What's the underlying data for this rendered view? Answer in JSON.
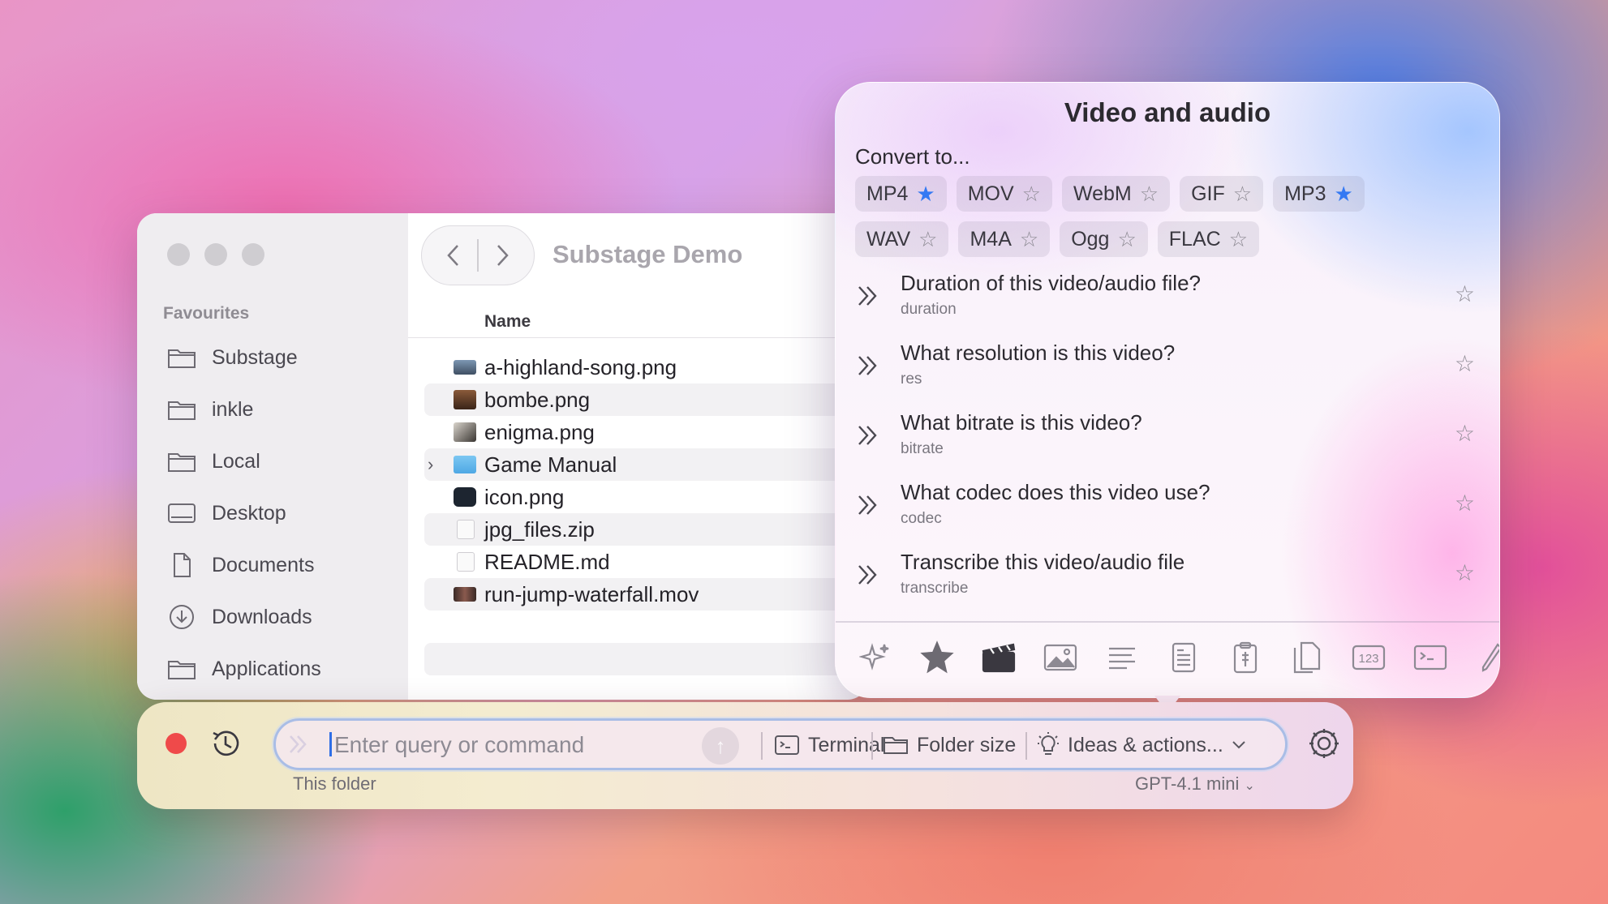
{
  "finder": {
    "sidebar_section": "Favourites",
    "sidebar_items": [
      {
        "label": "Substage",
        "icon": "folder-icon"
      },
      {
        "label": "inkle",
        "icon": "folder-icon"
      },
      {
        "label": "Local",
        "icon": "folder-icon"
      },
      {
        "label": "Desktop",
        "icon": "desktop-icon"
      },
      {
        "label": "Documents",
        "icon": "document-icon"
      },
      {
        "label": "Downloads",
        "icon": "download-icon"
      },
      {
        "label": "Applications",
        "icon": "folder-icon"
      }
    ],
    "title": "Substage Demo",
    "column_name": "Name",
    "files": [
      {
        "name": "a-highland-song.png"
      },
      {
        "name": "bombe.png"
      },
      {
        "name": "enigma.png"
      },
      {
        "name": "Game Manual"
      },
      {
        "name": "icon.png"
      },
      {
        "name": "jpg_files.zip"
      },
      {
        "name": "README.md"
      },
      {
        "name": "run-jump-waterfall.mov"
      }
    ]
  },
  "popover": {
    "title": "Video and audio",
    "subtitle": "Convert to...",
    "formats": [
      {
        "label": "MP4",
        "starred": true
      },
      {
        "label": "MOV",
        "starred": false
      },
      {
        "label": "WebM",
        "starred": false
      },
      {
        "label": "GIF",
        "starred": false
      },
      {
        "label": "MP3",
        "starred": true
      },
      {
        "label": "WAV",
        "starred": false
      },
      {
        "label": "M4A",
        "starred": false
      },
      {
        "label": "Ogg",
        "starred": false
      },
      {
        "label": "FLAC",
        "starred": false
      }
    ],
    "actions": [
      {
        "title": "Duration of this video/audio file?",
        "command": "duration"
      },
      {
        "title": "What resolution is this video?",
        "command": "res"
      },
      {
        "title": "What bitrate is this video?",
        "command": "bitrate"
      },
      {
        "title": "What codec does this video use?",
        "command": "codec"
      },
      {
        "title": "Transcribe this video/audio file",
        "command": "transcribe"
      }
    ],
    "toolbar_icons": [
      "sparkles-icon",
      "star-icon",
      "clapperboard-icon",
      "image-icon",
      "text-lines-icon",
      "text-document-icon",
      "clipboard-icon",
      "copy-files-icon",
      "numbers-123-icon",
      "terminal-icon",
      "pencil-icon"
    ],
    "toolbar_numbers_label": "123"
  },
  "bar": {
    "placeholder": "Enter query or command",
    "terminal_label": "Terminal",
    "folder_size_label": "Folder size",
    "ideas_label": "Ideas & actions...",
    "context_label": "This folder",
    "model_label": "GPT-4.1 mini"
  },
  "colors": {
    "accent_star": "#3479f3",
    "record": "#ef4a4a",
    "caret": "#2f6fe6"
  }
}
